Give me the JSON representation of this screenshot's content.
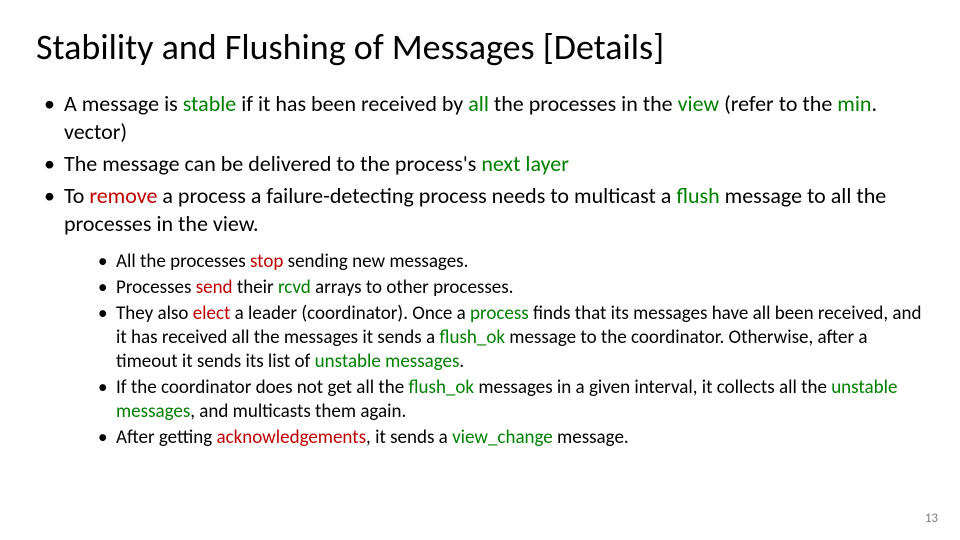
{
  "title": "Stability and Flushing of Messages [Details]",
  "outer": [
    {
      "pre": " A message is ",
      "k1": "stable",
      "mid1": " if it has been received by ",
      "k2": "all",
      "mid2": " the processes in the ",
      "k3": "view",
      "tail1": " (refer to the ",
      "k4": "min",
      "tail2": ". vector)"
    },
    {
      "pre": "The message can be delivered to the process's ",
      "k1": "next layer",
      "tail": ""
    },
    {
      "pre": "To ",
      "k1": "remove",
      "mid1": " a process a failure-detecting process needs to multicast a ",
      "k2": "flush",
      "tail1": " message to all the processes in the view."
    }
  ],
  "inner": [
    {
      "pre": "All the processes ",
      "k1": "stop",
      "tail": " sending new messages."
    },
    {
      "pre": "Processes ",
      "k1": "send",
      "mid1": " their ",
      "k2": "rcvd",
      "tail": " arrays to other processes."
    },
    {
      "pre": "They also ",
      "k1": "elect",
      "mid1": " a leader (coordinator). Once a ",
      "k2": "process",
      "mid2": " finds that its messages have all been received, and it has received all the messages it sends a ",
      "k3": "flush_ok",
      "mid3": " message to the coordinator. Otherwise, after a timeout it sends its list of ",
      "k4": "unstable messages",
      "tail": "."
    },
    {
      "pre": "If the coordinator does not get all the ",
      "k1": "flush_ok",
      "mid1": " messages in a given interval, it collects all the ",
      "k2": "unstable messages",
      "tail": ", and multicasts them again."
    },
    {
      "pre": "After getting ",
      "k1": "acknowledgements",
      "mid1": ", it sends a ",
      "k2": "view_change",
      "tail": " message."
    }
  ],
  "page": "13"
}
